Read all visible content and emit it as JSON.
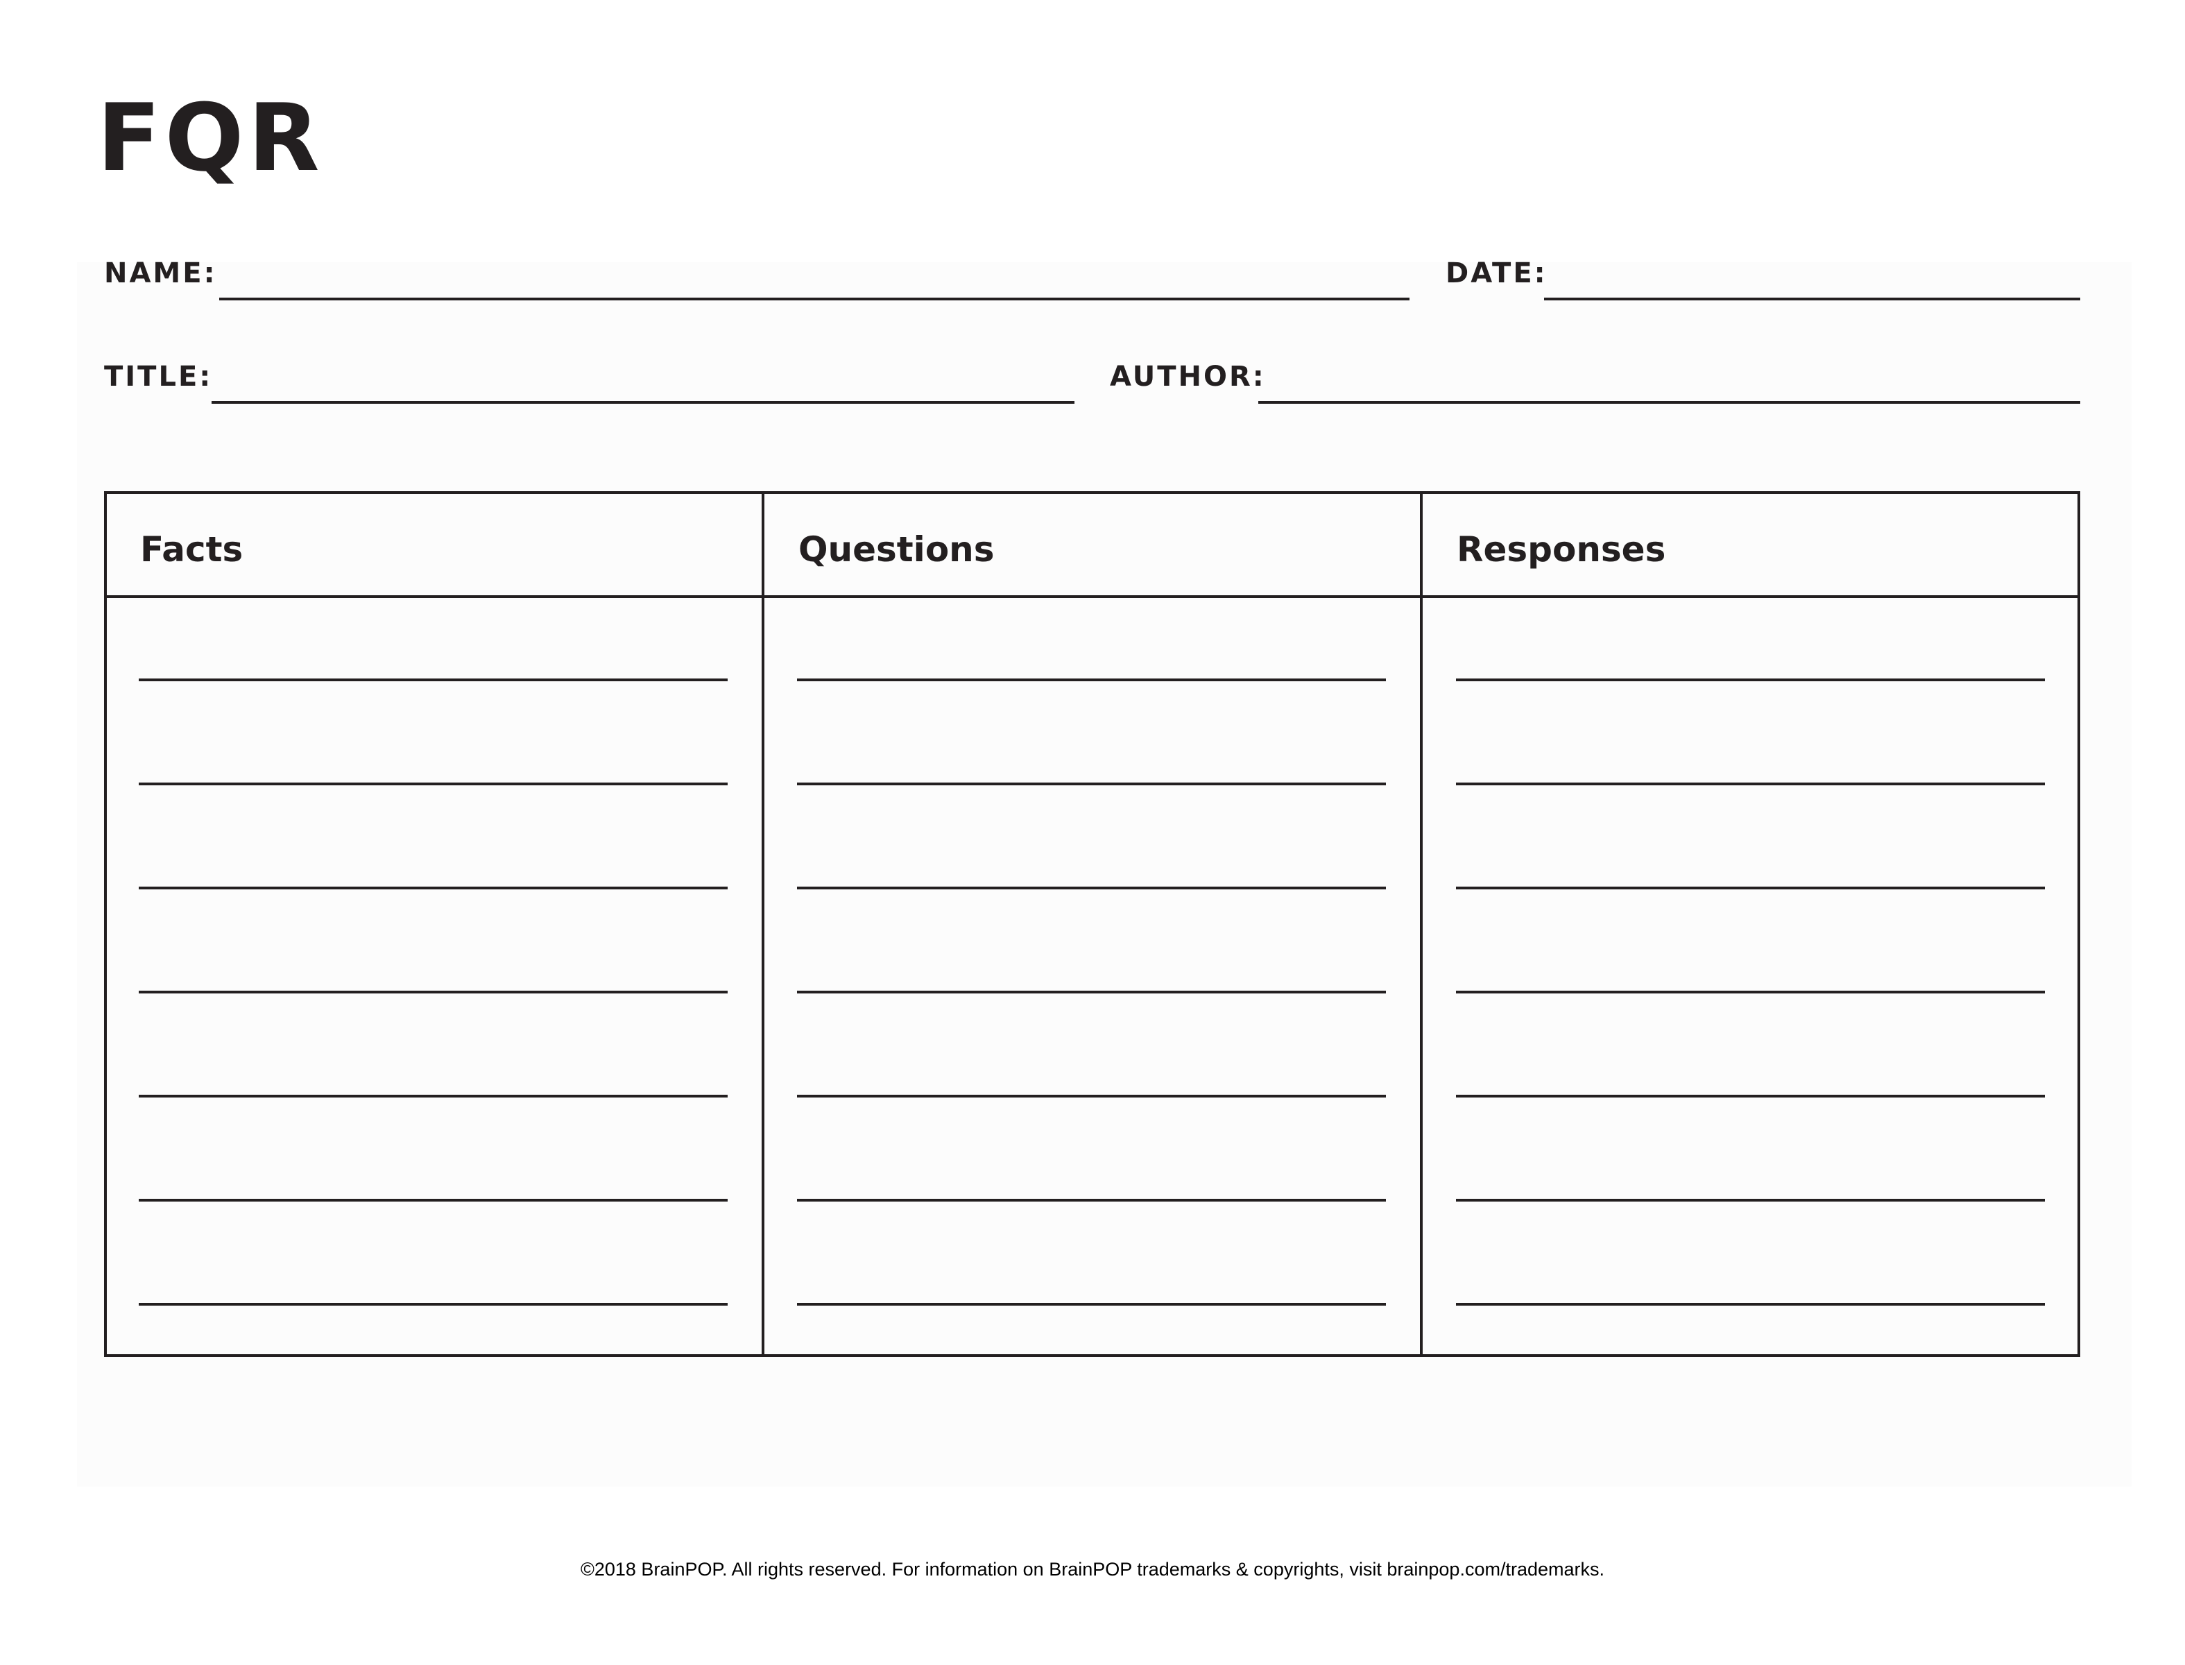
{
  "worksheet": {
    "title": "FQR",
    "fields": {
      "name_label": "NAME:",
      "name_value": "",
      "date_label": "DATE:",
      "date_value": "",
      "title_label": "TITLE:",
      "title_value": "",
      "author_label": "AUTHOR:",
      "author_value": ""
    },
    "table": {
      "columns": [
        {
          "heading": "Facts",
          "lines": [
            "",
            "",
            "",
            "",
            "",
            "",
            ""
          ]
        },
        {
          "heading": "Questions",
          "lines": [
            "",
            "",
            "",
            "",
            "",
            "",
            ""
          ]
        },
        {
          "heading": "Responses",
          "lines": [
            "",
            "",
            "",
            "",
            "",
            "",
            ""
          ]
        }
      ]
    },
    "footer": "©2018 BrainPOP. All rights reserved. For information on BrainPOP trademarks & copyrights, visit brainpop.com/trademarks."
  },
  "colors": {
    "ink": "#231f20",
    "panel": "#fcfcfc",
    "page": "#ffffff"
  }
}
